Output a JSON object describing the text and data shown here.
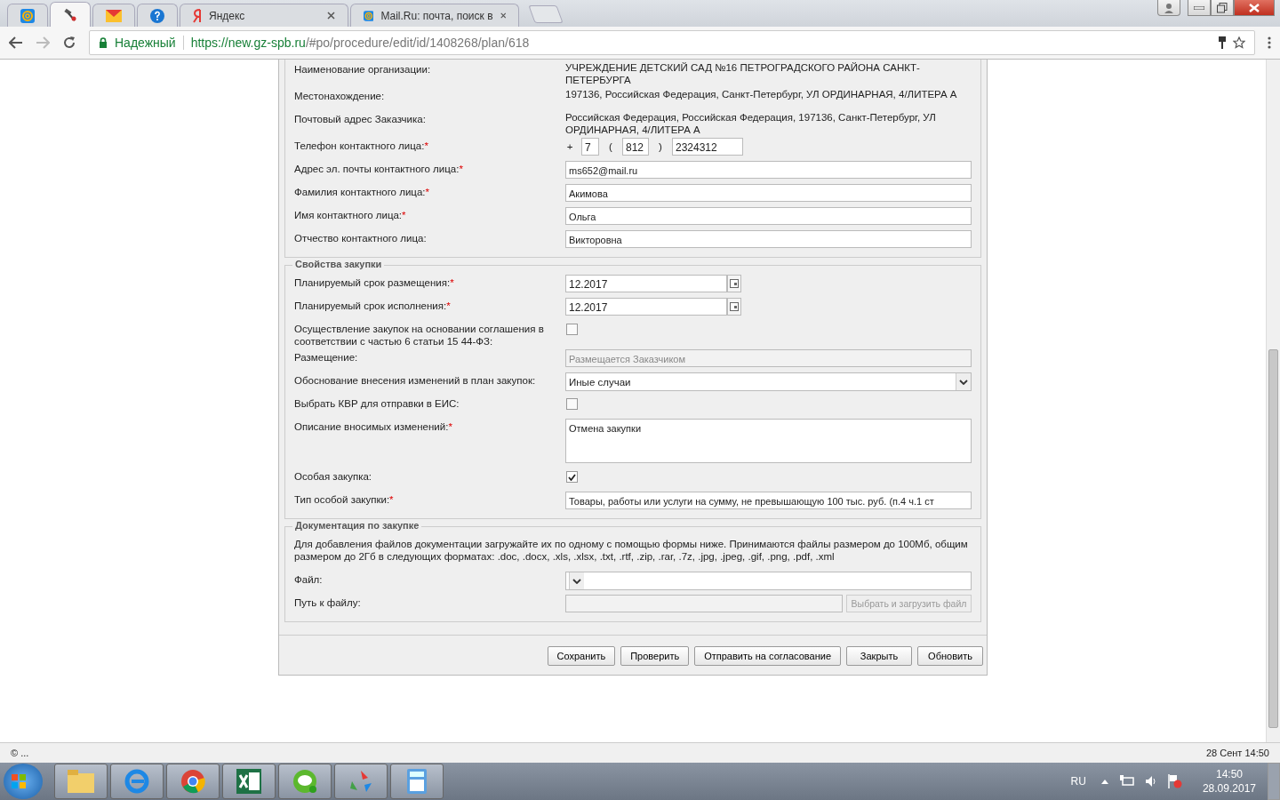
{
  "browser": {
    "tabs": [
      {
        "selected": false
      },
      {
        "selected": true
      },
      {
        "selected": false
      },
      {
        "selected": false
      },
      {
        "title": "Яндекс",
        "selected": false
      },
      {
        "title": "Mail.Ru: почта, поиск в",
        "selected": false
      }
    ],
    "secure_label": "Надежный",
    "url_host": "https://new.gz-spb.ru",
    "url_path": "/#po/procedure/edit/id/1408268/plan/618"
  },
  "sections": [
    {
      "rows": [
        {
          "kind": "text",
          "label": "Наименование организации:",
          "value": "УЧРЕЖДЕНИЕ ДЕТСКИЙ САД №16 ПЕТРОГРАДСКОГО РАЙОНА САНКТ-ПЕТЕРБУРГА"
        },
        {
          "kind": "text",
          "label": "Местонахождение:",
          "value": "197136, Российская Федерация, Санкт-Петербург, УЛ ОРДИНАРНАЯ, 4/ЛИТЕРА А"
        },
        {
          "kind": "text",
          "label": "Почтовый адрес Заказчика:",
          "value": "Российская Федерация, Российская Федерация, 197136, Санкт-Петербург, УЛ ОРДИНАРНАЯ, 4/ЛИТЕРА А"
        },
        {
          "kind": "phone",
          "label": "Телефон контактного лица:",
          "mark": "*",
          "plus": "+",
          "country": "7",
          "open": "(",
          "area": "812",
          "close": ")",
          "number": "2324312"
        },
        {
          "kind": "input",
          "label": "Адрес эл. почты контактного лица:",
          "mark": "*",
          "value": "ms652@mail.ru"
        },
        {
          "kind": "input",
          "label": "Фамилия контактного лица:",
          "mark": "*",
          "value": "Акимова"
        },
        {
          "kind": "input",
          "label": "Имя контактного лица:",
          "mark": "*",
          "value": "Ольга"
        },
        {
          "kind": "input",
          "label": "Отчество контактного лица:",
          "value": "Викторовна"
        }
      ]
    },
    {
      "legend": "Свойства закупки",
      "rows": [
        {
          "kind": "date",
          "label": "Планируемый срок размещения:",
          "mark": "*",
          "value": "12.2017"
        },
        {
          "kind": "date",
          "label": "Планируемый срок исполнения:",
          "mark": "*",
          "value": "12.2017"
        },
        {
          "kind": "checkbox",
          "label": "Осуществление закупок на основании соглашения в соответствии с частью 6 статьи 15 44-ФЗ:",
          "checked": false
        },
        {
          "kind": "readonly",
          "label": "Размещение:",
          "value": "Размещается Заказчиком"
        },
        {
          "kind": "select",
          "label": "Обоснование внесения изменений в план закупок:",
          "value": "Иные случаи"
        },
        {
          "kind": "checkbox",
          "label": "Выбрать КВР для отправки в ЕИС:",
          "checked": false
        },
        {
          "kind": "textarea",
          "label": "Описание вносимых изменений:",
          "mark": "*",
          "value": "Отмена закупки"
        },
        {
          "kind": "checkbox",
          "label": "Особая закупка:",
          "checked": true
        },
        {
          "kind": "input",
          "label": "Тип особой закупки:",
          "mark": "*",
          "value": "Товары, работы или услуги на сумму, не превышающую 100 тыс. руб. (п.4 ч.1 ст"
        }
      ]
    },
    {
      "legend": "Документация по закупке",
      "note": "Для добавления файлов документации загружайте их по одному с помощью формы ниже. Принимаются файлы размером до 100Мб, общим размером до 2Гб в следующих форматах: .doc, .docx, .xls, .xlsx, .txt, .rtf, .zip, .rar, .7z, .jpg, .jpeg, .gif, .png, .pdf, .xml",
      "rows": [
        {
          "kind": "select",
          "label": "Файл:"
        },
        {
          "kind": "upload",
          "label": "Путь к файлу:",
          "button": "Выбрать и загрузить файл"
        }
      ]
    }
  ],
  "buttons": [
    "Сохранить",
    "Проверить",
    "Отправить на согласование",
    "Закрыть",
    "Обновить"
  ],
  "status_bar": {
    "left": "© ...",
    "right": "28 Сент 14:50"
  },
  "taskbar": {
    "language": "RU",
    "time": "14:50",
    "date": "28.09.2017"
  }
}
